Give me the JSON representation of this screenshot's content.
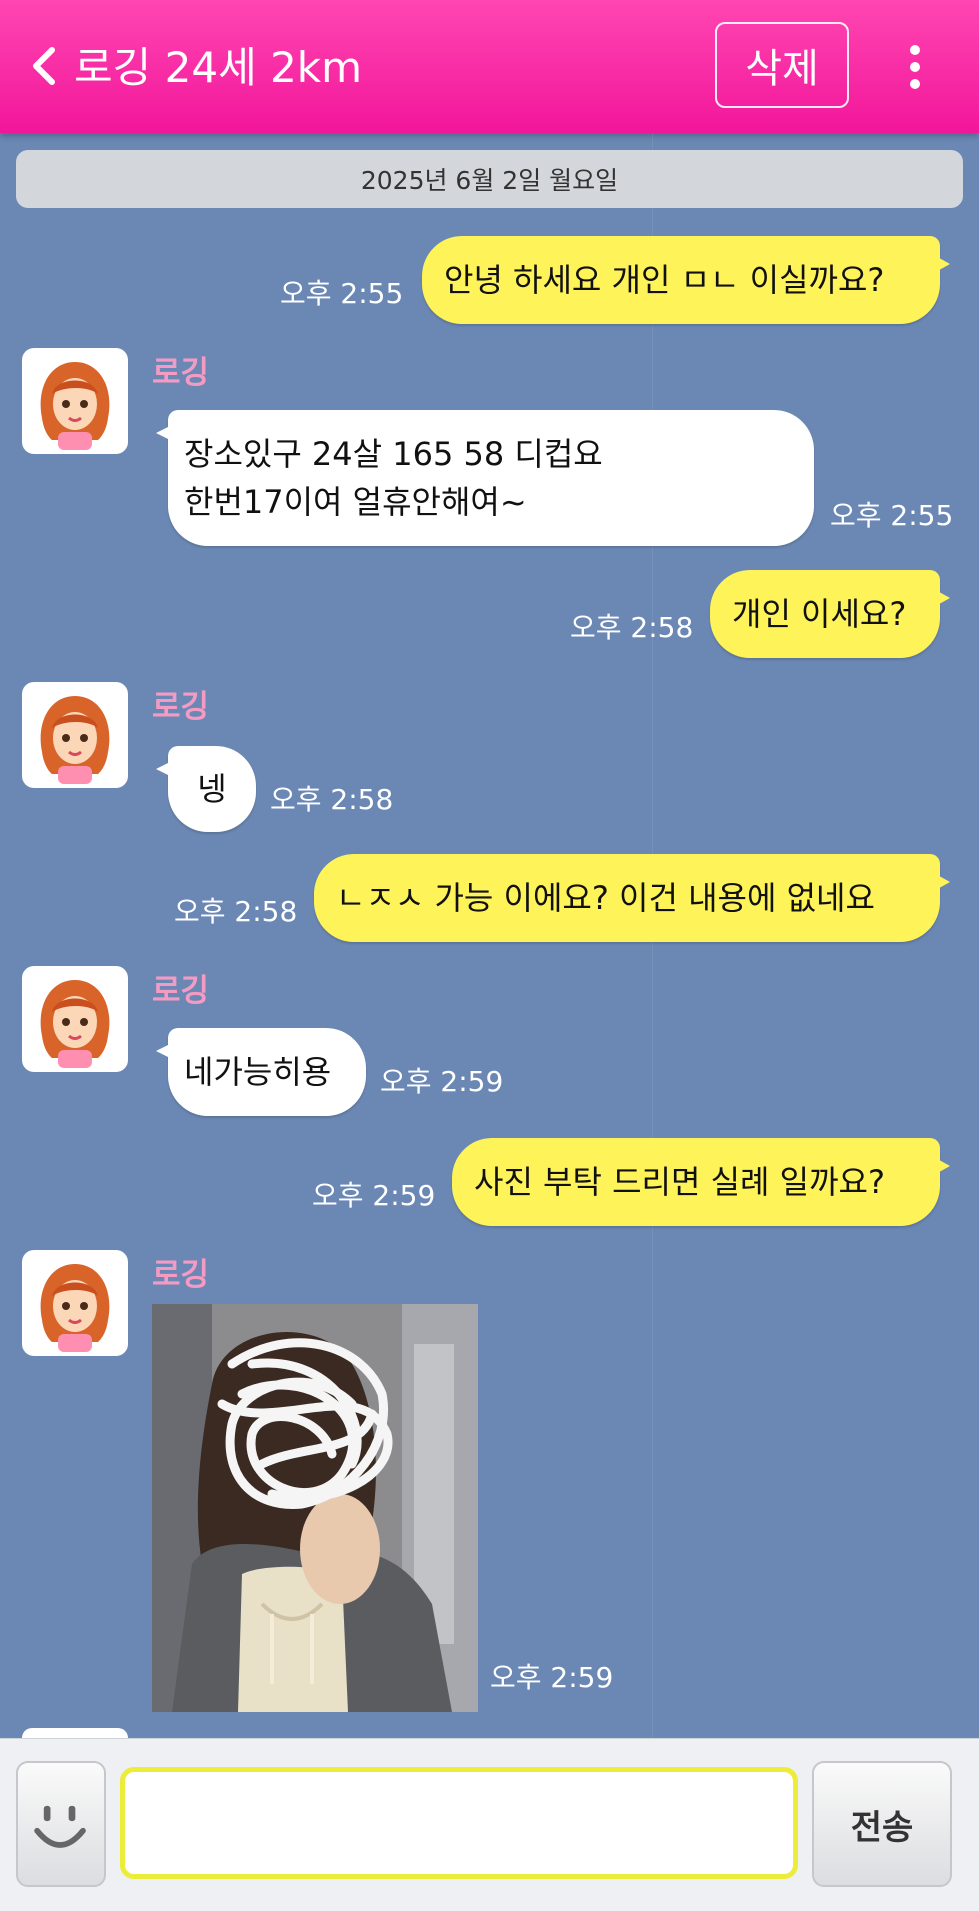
{
  "header": {
    "title": "로깅 24세 2km",
    "delete_label": "삭제",
    "icons": [
      "chevron-left-icon",
      "more-vertical-icon"
    ]
  },
  "date_divider": "2025년 6월 2일 월요일",
  "messages": [
    {
      "direction": "out",
      "text": "안녕 하세요 개인 ㅁㄴ 이실까요?",
      "time": "오후 2:55"
    },
    {
      "direction": "in",
      "sender": "로깅",
      "lines": [
        "장소있구 24살 165 58 디컵요",
        "한번17이여 얼휴안해여~"
      ],
      "time": "오후 2:55"
    },
    {
      "direction": "out",
      "text": "개인 이세요?",
      "time": "오후 2:58"
    },
    {
      "direction": "in",
      "sender": "로깅",
      "text": "넹",
      "time": "오후 2:58"
    },
    {
      "direction": "out",
      "text": "ㄴㅈㅅ 가능 이에요? 이건 내용에 없네요",
      "time": "오후 2:58"
    },
    {
      "direction": "in",
      "sender": "로깅",
      "text": "네가능히용",
      "time": "오후 2:59"
    },
    {
      "direction": "out",
      "text": "사진 부탁 드리면 실례 일까요?",
      "time": "오후 2:59"
    },
    {
      "direction": "in",
      "sender": "로깅",
      "type": "photo",
      "time": "오후 2:59"
    }
  ],
  "composer": {
    "placeholder": "",
    "send_label": "전송",
    "icons": [
      "smiley-icon"
    ]
  },
  "colors": {
    "header": "#f2169a",
    "background": "#6b88b4",
    "outgoing_bubble": "#fff35a",
    "incoming_bubble": "#ffffff",
    "sender_name": "#f49bc4"
  }
}
